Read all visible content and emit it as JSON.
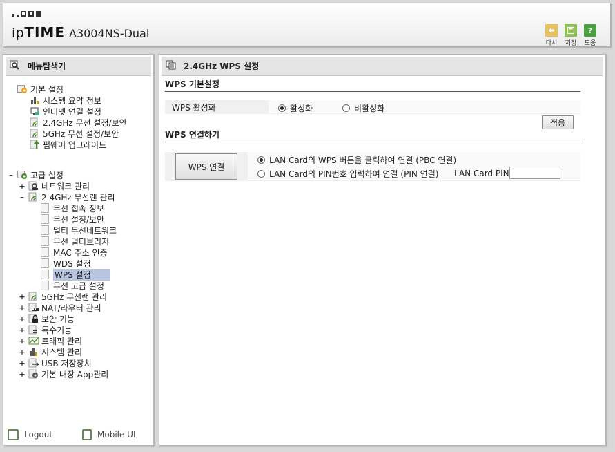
{
  "header": {
    "brand_prefix": "ip",
    "brand_main": "TIME",
    "model": "A3004NS-Dual",
    "buttons": [
      {
        "label": "다시",
        "icon": "refresh-icon",
        "color": "#e8c060"
      },
      {
        "label": "저장",
        "icon": "save-icon",
        "color": "#8cc050"
      },
      {
        "label": "도움",
        "icon": "help-icon",
        "color": "#4ca040",
        "glyph": "?"
      }
    ]
  },
  "sidebar": {
    "title": "메뉴탐색기",
    "basic": {
      "label": "기본 설정",
      "items": [
        "시스템 요약 정보",
        "인터넷 연결 설정",
        "2.4GHz 무선 설정/보안",
        "5GHz 무선 설정/보안",
        "펌웨어 업그레이드"
      ]
    },
    "advanced": {
      "label": "고급 설정",
      "network": "네트워크 관리",
      "wlan24": "2.4GHz 무선랜 관리",
      "wlan24_items": [
        "무선 접속 정보",
        "무선 설정/보안",
        "멀티 무선네트워크",
        "무선 멀티브리지",
        "MAC 주소 인증",
        "WDS 설정",
        "WPS 설정",
        "무선 고급 설정"
      ],
      "selected_index": 6,
      "others": [
        "5GHz 무선랜 관리",
        "NAT/라우터 관리",
        "보안 기능",
        "특수기능",
        "트래픽 관리",
        "시스템 관리",
        "USB 저장장치",
        "기본 내장 App관리"
      ]
    },
    "footer": {
      "logout": "Logout",
      "mobile": "Mobile UI"
    }
  },
  "main": {
    "title": "2.4GHz WPS 설정",
    "basic_section": "WPS 기본설정",
    "wps_enable_label": "WPS 활성화",
    "enable_option": "활성화",
    "disable_option": "비활성화",
    "enabled": true,
    "apply_button": "적용",
    "connect_section": "WPS 연결하기",
    "connect_button": "WPS 연결",
    "pbc_option": "LAN Card의 WPS 버튼을 클릭하여 연결 (PBC 연결)",
    "pin_option": "LAN Card의 PIN번호 입력하여 연결 (PIN 연결)",
    "pin_label": "LAN Card PIN",
    "pin_value": "",
    "pbc_selected": true
  }
}
